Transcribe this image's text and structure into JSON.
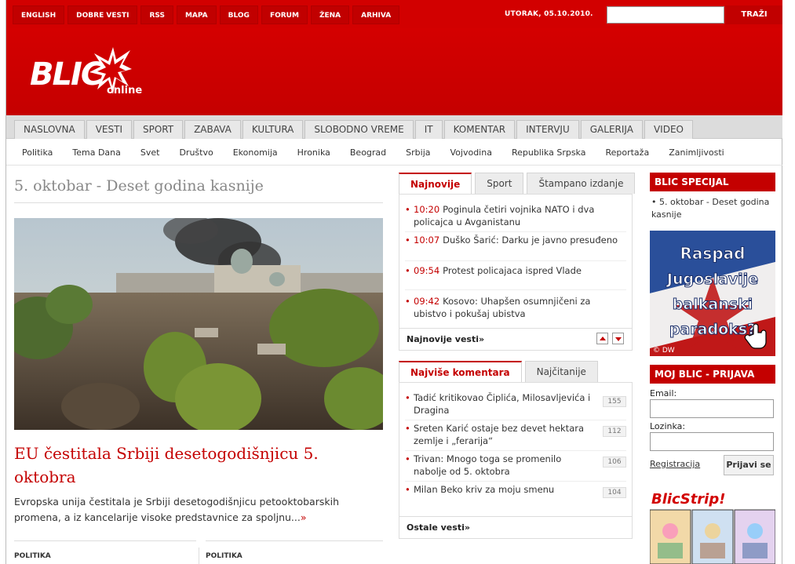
{
  "top_links": [
    "ENGLISH",
    "DOBRE VESTI",
    "RSS",
    "MAPA",
    "BLOG",
    "FORUM",
    "ŽENA",
    "ARHIVA"
  ],
  "date": "UTORAK, 05.10.2010.",
  "search": {
    "button": "TRAŽI"
  },
  "logo": {
    "brand": "BLIC",
    "sub": "online"
  },
  "main_nav": [
    "NASLOVNA",
    "VESTI",
    "SPORT",
    "ZABAVA",
    "KULTURA",
    "SLOBODNO VREME",
    "IT",
    "KOMENTAR",
    "INTERVJU",
    "GALERIJA",
    "VIDEO"
  ],
  "sub_nav": [
    "Politika",
    "Tema Dana",
    "Svet",
    "Društvo",
    "Ekonomija",
    "Hronika",
    "Beograd",
    "Srbija",
    "Vojvodina",
    "Republika Srpska",
    "Reportaža",
    "Zanimljivosti"
  ],
  "main": {
    "page_title": "5. oktobar - Deset godina kasnije",
    "headline": "EU čestitala Srbiji desetogodišnjicu 5. oktobra",
    "lead": "Evropska unija čestitala je Srbiji desetogodišnjicu petooktobarskih promena, a iz kancelarije visoke predstavnice za spoljnu...",
    "lead_more": "»",
    "section_left": "POLITIKA",
    "section_right": "POLITIKA"
  },
  "latest": {
    "tabs": [
      "Najnovije",
      "Sport",
      "Štampano izdanje"
    ],
    "items": [
      {
        "time": "10:20",
        "text": "Poginula četiri vojnika NATO i dva policajca u Avganistanu"
      },
      {
        "time": "10:07",
        "text": "Duško Šarić: Darku je javno presuđeno"
      },
      {
        "time": "09:54",
        "text": "Protest policajaca ispred Vlade"
      },
      {
        "time": "09:42",
        "text": "Kosovo: Uhapšen osumnjičeni za ubistvo i pokušaj ubistva"
      }
    ],
    "footer": "Najnovije vesti»"
  },
  "comments": {
    "tabs": [
      "Najviše komentara",
      "Najčitanije"
    ],
    "items": [
      {
        "text": "Tadić kritikovao Čiplića, Milosavljevića i Dragina",
        "count": "155"
      },
      {
        "text": "Sreten Karić ostaje bez devet hektara zemlje i „ferarija“",
        "count": "112"
      },
      {
        "text": "Trivan: Mnogo toga se promenilo nabolje od 5. oktobra",
        "count": "106"
      },
      {
        "text": "Milan Beko kriv za moju smenu",
        "count": "104"
      }
    ],
    "footer": "Ostale vesti»"
  },
  "sidebar": {
    "special_title": "BLIC SPECIJAL",
    "special_link": "5. oktobar - Deset godina kasnije",
    "banner_lines": [
      "Raspad",
      "Jugoslavije",
      "balkanski",
      "paradoks?"
    ],
    "banner_credit": "© DW",
    "login_title": "MOJ BLIC - PRIJAVA",
    "email_label": "Email:",
    "password_label": "Lozinka:",
    "register": "Registracija",
    "login_button": "Prijavi se",
    "strip_title": "BlicStrip!"
  },
  "colors": {
    "brand_red": "#d20000",
    "link_red": "#c40000"
  }
}
